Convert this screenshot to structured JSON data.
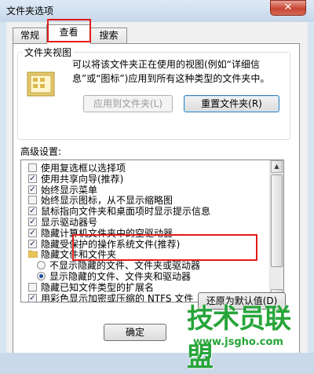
{
  "window": {
    "title": "文件夹选项",
    "close_glyph": "✕"
  },
  "tabs": [
    {
      "label": "常规"
    },
    {
      "label": "查看"
    },
    {
      "label": "搜索"
    }
  ],
  "folder_views": {
    "group_title": "文件夹视图",
    "description": "可以将该文件夹正在使用的视图(例如“详细信息”或“图标”)应用到所有这种类型的文件夹中。",
    "apply_button": "应用到文件夹(L)",
    "reset_button": "重置文件夹(R)"
  },
  "advanced": {
    "label": "高级设置:",
    "items": [
      {
        "type": "checkbox",
        "checked": false,
        "label": "使用复选框以选择项"
      },
      {
        "type": "checkbox",
        "checked": true,
        "label": "使用共享向导(推荐)"
      },
      {
        "type": "checkbox",
        "checked": true,
        "label": "始终显示菜单"
      },
      {
        "type": "checkbox",
        "checked": false,
        "label": "始终显示图标，从不显示缩略图"
      },
      {
        "type": "checkbox",
        "checked": true,
        "label": "鼠标指向文件夹和桌面项时显示提示信息"
      },
      {
        "type": "checkbox",
        "checked": true,
        "label": "显示驱动器号"
      },
      {
        "type": "checkbox",
        "checked": true,
        "label": "隐藏计算机文件夹中的空驱动器"
      },
      {
        "type": "checkbox",
        "checked": true,
        "label": "隐藏受保护的操作系统文件(推荐)"
      },
      {
        "type": "folder",
        "label": "隐藏文件和文件夹"
      },
      {
        "type": "radio",
        "checked": false,
        "label": "不显示隐藏的文件、文件夹或驱动器"
      },
      {
        "type": "radio",
        "checked": true,
        "label": "显示隐藏的文件、文件夹和驱动器"
      },
      {
        "type": "checkbox",
        "checked": false,
        "label": "隐藏已知文件类型的扩展名"
      },
      {
        "type": "checkbox",
        "checked": true,
        "label": "用彩色显示加密或压缩的 NTFS 文件"
      }
    ],
    "restore_button": "还原为默认值(D)"
  },
  "bottom_buttons": {
    "ok": "确定"
  },
  "watermark": {
    "main": "技术员联盟",
    "url": "www.jsgho.com"
  },
  "colors": {
    "highlight_box": "#e11b1b",
    "watermark": "#27a539",
    "radio_dot": "#1a4f9e"
  }
}
